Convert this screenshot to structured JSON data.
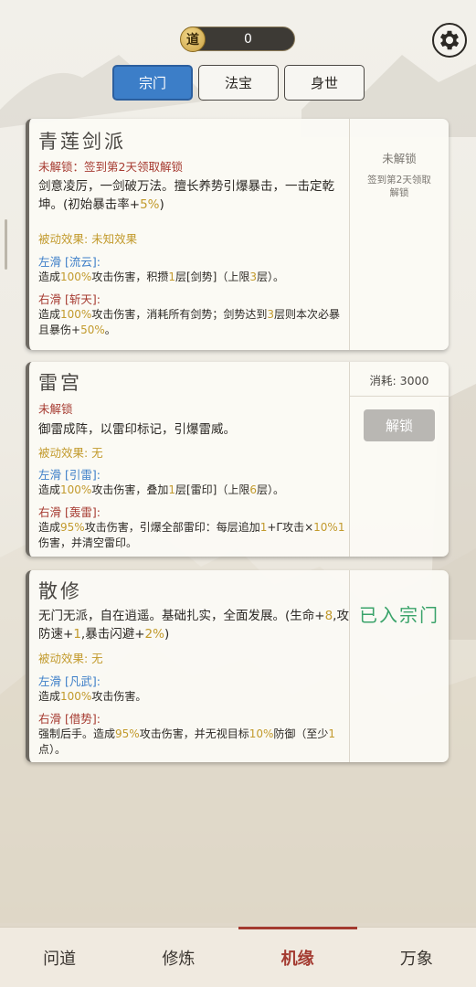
{
  "top": {
    "dao_label": "道",
    "dao_count": "0"
  },
  "tabs": [
    {
      "label": "宗门",
      "active": true
    },
    {
      "label": "法宝",
      "active": false
    },
    {
      "label": "身世",
      "active": false
    }
  ],
  "sects": [
    {
      "title": "青莲剑派",
      "status": "未解锁：签到第2天领取解锁",
      "desc_a": "剑意凌厉，一剑破万法。擅长养势引爆暴击，一击定乾坤。(初始暴击率+",
      "desc_num": "5%",
      "desc_b": ")",
      "passive": "被动效果: 未知效果",
      "left_label": "左滑 [流云]:",
      "left_effect": [
        "造成",
        "100%",
        "攻击伤害，积攒",
        "1",
        "层[剑势]（上限",
        "3",
        "层）。"
      ],
      "right_label": "右滑 [斩天]:",
      "right_effect": [
        "造成",
        "100%",
        "攻击伤害，消耗所有剑势；剑势达到",
        "3",
        "层则本次必暴且暴伤+",
        "50%",
        "。"
      ],
      "side_status": "未解锁",
      "side_hint": "签到第2天领取解锁"
    },
    {
      "title": "雷宫",
      "status": "未解锁",
      "desc": "御雷成阵，以雷印标记，引爆雷威。",
      "passive": "被动效果: 无",
      "left_label": "左滑 [引雷]:",
      "left_effect": [
        "造成",
        "100%",
        "攻击伤害，叠加",
        "1",
        "层[雷印]（上限",
        "6",
        "层）。"
      ],
      "right_label": "右滑 [轰雷]:",
      "right_effect": [
        "造成",
        "95%",
        "攻击伤害，引爆全部雷印：每层追加",
        "1",
        "+Γ攻击×",
        "10%",
        "",
        "1",
        "伤害，并清空雷印。"
      ],
      "side_cost": "消耗: 3000",
      "side_button": "解锁"
    },
    {
      "title": "散修",
      "desc": [
        "无门无派，自在逍遥。基础扎实，全面发展。(生命+",
        "8",
        ",攻防速+",
        "1",
        ",暴击闪避+",
        "2%",
        ")"
      ],
      "passive": "被动效果: 无",
      "left_label": "左滑 [凡武]:",
      "left_effect": [
        "造成",
        "100%",
        "攻击伤害。"
      ],
      "right_label": "右滑 [借势]:",
      "right_effect": [
        "强制后手。造成",
        "95%",
        "攻击伤害，并无视目标",
        "10%",
        "防御（至少",
        "1",
        "点）。"
      ],
      "side_status": "已入宗门"
    }
  ],
  "nav": [
    {
      "label": "问道",
      "active": false
    },
    {
      "label": "修炼",
      "active": false
    },
    {
      "label": "机缘",
      "active": true
    },
    {
      "label": "万象",
      "active": false
    }
  ],
  "colors": {
    "accent_blue": "#3c7ec8",
    "accent_red": "#a63a30",
    "gold": "#c29a2c",
    "green": "#3aa36a"
  }
}
